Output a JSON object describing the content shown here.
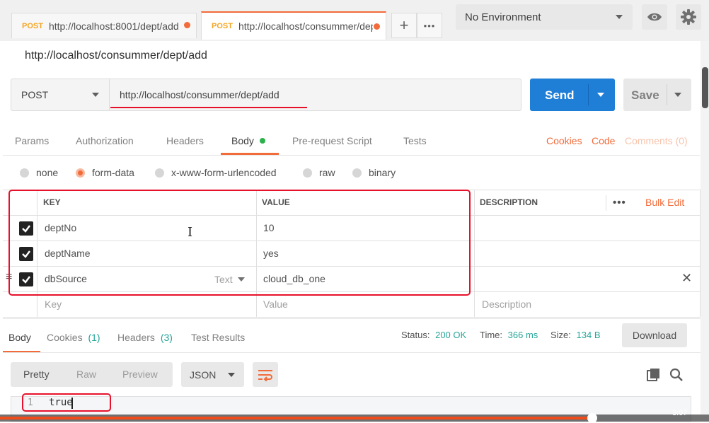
{
  "tabs": [
    {
      "method": "POST",
      "url": "http://localhost:8001/dept/add"
    },
    {
      "method": "POST",
      "url": "http://localhost/consummer/dept/add"
    }
  ],
  "tab_actions": {
    "add": "+",
    "more": "•••"
  },
  "environment": {
    "selected": "No Environment"
  },
  "request": {
    "title": "http://localhost/consummer/dept/add",
    "method": "POST",
    "url": "http://localhost/consummer/dept/add",
    "send_label": "Send",
    "save_label": "Save"
  },
  "request_tabs": [
    "Params",
    "Authorization",
    "Headers",
    "Body",
    "Pre-request Script",
    "Tests"
  ],
  "request_links": {
    "cookies": "Cookies",
    "code": "Code",
    "comments": "Comments (0)"
  },
  "body_types": [
    "none",
    "form-data",
    "x-www-form-urlencoded",
    "raw",
    "binary"
  ],
  "body_type_selected": "form-data",
  "table": {
    "headers": {
      "key": "KEY",
      "value": "VALUE",
      "description": "DESCRIPTION"
    },
    "bulk_edit": "Bulk Edit",
    "rows": [
      {
        "key": "deptNo",
        "value": "10"
      },
      {
        "key": "deptName",
        "value": "yes"
      },
      {
        "key": "dbSource",
        "value": "cloud_db_one",
        "type": "Text"
      }
    ],
    "placeholders": {
      "key": "Key",
      "value": "Value",
      "description": "Description"
    }
  },
  "response": {
    "tabs": [
      {
        "label": "Body",
        "count": ""
      },
      {
        "label": "Cookies",
        "count": "(1)"
      },
      {
        "label": "Headers",
        "count": "(3)"
      },
      {
        "label": "Test Results",
        "count": ""
      }
    ],
    "status_label": "Status:",
    "status_value": "200 OK",
    "time_label": "Time:",
    "time_value": "366 ms",
    "size_label": "Size:",
    "size_value": "134 B",
    "download_label": "Download",
    "view_modes": [
      "Pretty",
      "Raw",
      "Preview"
    ],
    "format": "JSON",
    "line_number": "1",
    "body": "true"
  },
  "video": {
    "time": "3:07",
    "progress": 0.835
  },
  "colors": {
    "accent": "#f26b3a",
    "send": "#1f7ed6",
    "ok": "#26a69a",
    "highlight": "#e8102b"
  }
}
